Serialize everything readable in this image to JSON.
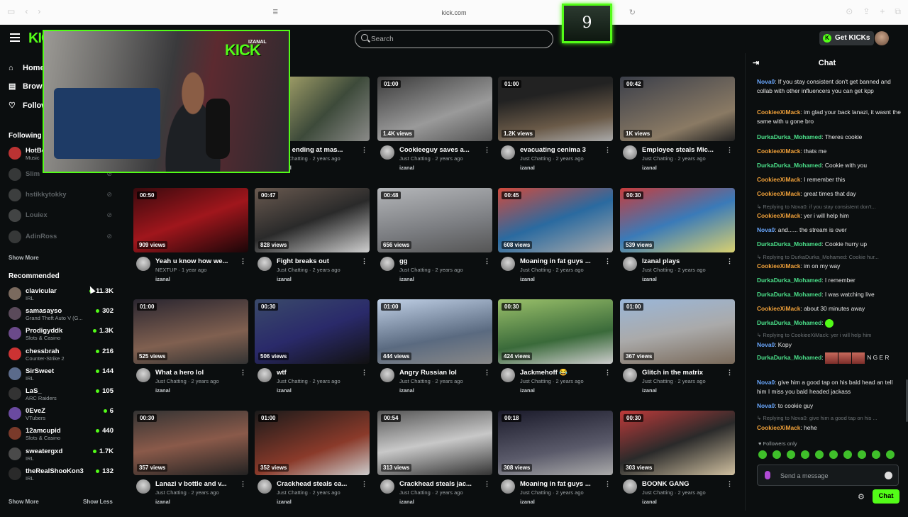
{
  "browser": {
    "url": "kick.com"
  },
  "counter": {
    "value": "9"
  },
  "header": {
    "logo": "KICK",
    "search_placeholder": "Search",
    "get_kicks": "Get KICKs"
  },
  "nav": [
    {
      "label": "Home",
      "icon": "home-icon"
    },
    {
      "label": "Browse",
      "icon": "browse-icon"
    },
    {
      "label": "Following",
      "icon": "heart-icon"
    }
  ],
  "following": {
    "title": "Following",
    "items": [
      {
        "name": "HotBox",
        "category": "Music",
        "viewers": ""
      },
      {
        "name": "Slim",
        "category": "",
        "viewers": ""
      },
      {
        "name": "hstikkytokky",
        "category": "",
        "viewers": ""
      },
      {
        "name": "Louiex",
        "category": "",
        "viewers": ""
      },
      {
        "name": "AdinRoss",
        "category": "",
        "viewers": ""
      }
    ],
    "show_more": "Show More"
  },
  "recommended": {
    "title": "Recommended",
    "items": [
      {
        "name": "clavicular",
        "category": "IRL",
        "viewers": "11.3K"
      },
      {
        "name": "samasayso",
        "category": "Grand Theft Auto V (G...",
        "viewers": "302"
      },
      {
        "name": "Prodigyddk",
        "category": "Slots & Casino",
        "viewers": "1.3K"
      },
      {
        "name": "chessbrah",
        "category": "Counter-Strike 2",
        "viewers": "216"
      },
      {
        "name": "SirSweet",
        "category": "IRL",
        "viewers": "144"
      },
      {
        "name": "LaS_",
        "category": "ARC Raiders",
        "viewers": "105"
      },
      {
        "name": "0EveZ",
        "category": "VTubers",
        "viewers": "6"
      },
      {
        "name": "12amcupid",
        "category": "Slots & Casino",
        "viewers": "440"
      },
      {
        "name": "sweatergxd",
        "category": "IRL",
        "viewers": "1.7K"
      },
      {
        "name": "theRealShooKon3",
        "category": "IRL",
        "viewers": "132"
      }
    ],
    "show_more": "Show More",
    "show_less": "Show Less"
  },
  "pip": {
    "handle": "IZANAL",
    "mark": "KICK"
  },
  "videos": [
    {
      "dur": "",
      "views": "",
      "title": "...by ending at mas...",
      "sub": "Just Chatting · 2 years ago",
      "ch": "izanal"
    },
    {
      "dur": "01:00",
      "views": "1.4K views",
      "title": "Cookieeguy saves a...",
      "sub": "Just Chatting · 2 years ago",
      "ch": "izanal"
    },
    {
      "dur": "01:00",
      "views": "1.2K views",
      "title": "evacuating cenima 3",
      "sub": "Just Chatting · 2 years ago",
      "ch": "izanal"
    },
    {
      "dur": "00:42",
      "views": "1K views",
      "title": "Employee steals Mic...",
      "sub": "Just Chatting · 2 years ago",
      "ch": "izanal"
    },
    {
      "dur": "00:50",
      "views": "909 views",
      "title": "Yeah u know how we...",
      "sub": "NEXTUP · 1 year ago",
      "ch": "izanal"
    },
    {
      "dur": "00:47",
      "views": "828 views",
      "title": "Fight breaks out",
      "sub": "Just Chatting · 2 years ago",
      "ch": "izanal"
    },
    {
      "dur": "00:48",
      "views": "656 views",
      "title": "gg",
      "sub": "Just Chatting · 2 years ago",
      "ch": "izanal"
    },
    {
      "dur": "00:45",
      "views": "608 views",
      "title": "Moaning in fat guys ...",
      "sub": "Just Chatting · 2 years ago",
      "ch": "izanal"
    },
    {
      "dur": "00:30",
      "views": "539 views",
      "title": "Izanal plays",
      "sub": "Just Chatting · 2 years ago",
      "ch": "izanal"
    },
    {
      "dur": "01:00",
      "views": "525 views",
      "title": "What a hero lol",
      "sub": "Just Chatting · 2 years ago",
      "ch": "izanal"
    },
    {
      "dur": "00:30",
      "views": "506 views",
      "title": "wtf",
      "sub": "Just Chatting · 2 years ago",
      "ch": "izanal"
    },
    {
      "dur": "01:00",
      "views": "444 views",
      "title": "Angry Russian lol",
      "sub": "Just Chatting · 2 years ago",
      "ch": "izanal"
    },
    {
      "dur": "00:30",
      "views": "424 views",
      "title": "Jackmehoff 😂",
      "sub": "Just Chatting · 2 years ago",
      "ch": "izanal"
    },
    {
      "dur": "01:00",
      "views": "367 views",
      "title": "Glitch in the matrix",
      "sub": "Just Chatting · 2 years ago",
      "ch": "izanal"
    },
    {
      "dur": "00:30",
      "views": "357 views",
      "title": "Lanazi v bottle and v...",
      "sub": "Just Chatting · 2 years ago",
      "ch": "izanal"
    },
    {
      "dur": "01:00",
      "views": "352 views",
      "title": "Crackhead steals ca...",
      "sub": "Just Chatting · 2 years ago",
      "ch": "izanal"
    },
    {
      "dur": "00:54",
      "views": "313 views",
      "title": "Crackhead steals jac...",
      "sub": "Just Chatting · 2 years ago",
      "ch": "izanal"
    },
    {
      "dur": "00:18",
      "views": "308 views",
      "title": "Moaning in fat guys ...",
      "sub": "Just Chatting · 2 years ago",
      "ch": "izanal"
    },
    {
      "dur": "00:30",
      "views": "303 views",
      "title": "BOONK GANG",
      "sub": "Just Chatting · 2 years ago",
      "ch": "izanal"
    }
  ],
  "chat": {
    "title": "Chat",
    "messages": [
      {
        "type": "msg",
        "user": "Nova0",
        "color": "#6aa8ff",
        "text": " If you stay consistent don't get banned and collab with other influencers you can get kpp"
      },
      {
        "type": "msg",
        "user": "CookieeXiMack",
        "color": "#f2a23a",
        "text": " im glad your back lanazi, it wasnt the same with u gone bro"
      },
      {
        "type": "msg",
        "user": "DurkaDurka_Mohamed",
        "color": "#4be08a",
        "text": " Theres cookie"
      },
      {
        "type": "msg",
        "user": "CookieeXiMack",
        "color": "#f2a23a",
        "text": " thats me"
      },
      {
        "type": "msg",
        "user": "DurkaDurka_Mohamed",
        "color": "#4be08a",
        "text": " Cookie with you"
      },
      {
        "type": "msg",
        "user": "CookieeXiMack",
        "color": "#f2a23a",
        "text": " I remember this"
      },
      {
        "type": "msg",
        "user": "CookieeXiMack",
        "color": "#f2a23a",
        "text": " great times that day"
      },
      {
        "type": "reply",
        "text": "↳ Replying to Nova0: if you stay consistent don't..."
      },
      {
        "type": "msg",
        "user": "CookieeXiMack",
        "color": "#f2a23a",
        "text": " yer i will help him"
      },
      {
        "type": "msg",
        "user": "Nova0",
        "color": "#6aa8ff",
        "text": " and...... the stream is over"
      },
      {
        "type": "msg",
        "user": "DurkaDurka_Mohamed",
        "color": "#4be08a",
        "text": " Cookie hurry up"
      },
      {
        "type": "reply",
        "text": "↳ Replying to DurkaDurka_Mohamed: Cookie hur..."
      },
      {
        "type": "msg",
        "user": "CookieeXiMack",
        "color": "#f2a23a",
        "text": " im on my way"
      },
      {
        "type": "msg",
        "user": "DurkaDurka_Mohamed",
        "color": "#4be08a",
        "text": " I remember"
      },
      {
        "type": "msg",
        "user": "DurkaDurka_Mohamed",
        "color": "#4be08a",
        "text": " I was watching live"
      },
      {
        "type": "msg",
        "user": "CookieeXiMack",
        "color": "#f2a23a",
        "text": " about 30 minutes away"
      },
      {
        "type": "msg",
        "user": "DurkaDurka_Mohamed",
        "color": "#4be08a",
        "text": ""
      },
      {
        "type": "reply",
        "text": "↳ Replying to CookieeXiMack: yer i will help him"
      },
      {
        "type": "msg",
        "user": "Nova0",
        "color": "#6aa8ff",
        "text": " Kopy"
      },
      {
        "type": "msg",
        "user": "DurkaDurka_Mohamed",
        "color": "#4be08a",
        "text": " N G E R"
      },
      {
        "type": "msg",
        "user": "Nova0",
        "color": "#6aa8ff",
        "text": " give him a good tap on his bald head an tell him I miss you bald headed jackass"
      },
      {
        "type": "msg",
        "user": "Nova0",
        "color": "#6aa8ff",
        "text": " to cookie guy"
      },
      {
        "type": "reply",
        "text": "↳ Replying to Nova0: give him a good tap on his ..."
      },
      {
        "type": "msg",
        "user": "CookieeXiMack",
        "color": "#f2a23a",
        "text": " hehe"
      }
    ],
    "followers_only": "Followers only",
    "placeholder": "Send a message",
    "send": "Chat"
  }
}
